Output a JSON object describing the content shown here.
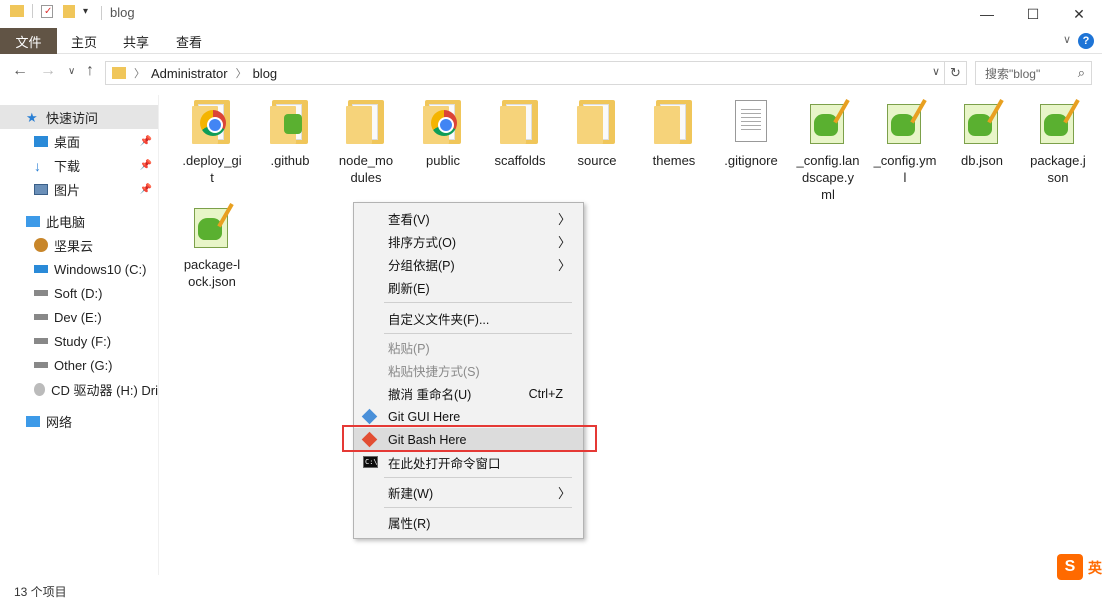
{
  "window": {
    "title": "blog",
    "minimize": "—",
    "maximize": "☐",
    "close": "✕"
  },
  "ribbon": {
    "file": "文件",
    "home": "主页",
    "share": "共享",
    "view": "查看",
    "collapse": "∨",
    "help": "?"
  },
  "nav": {
    "back": "←",
    "forward": "→",
    "recent": "∨",
    "up": "↑",
    "crumbs": [
      "Administrator",
      "blog"
    ],
    "search_placeholder": "搜索\"blog\""
  },
  "sidebar": {
    "items": [
      {
        "label": "快速访问",
        "icon": "star-icon"
      },
      {
        "label": "桌面",
        "icon": "desktop-icon"
      },
      {
        "label": "下载",
        "icon": "download-icon"
      },
      {
        "label": "图片",
        "icon": "pictures-icon"
      },
      {
        "label": "此电脑",
        "icon": "computer-icon"
      },
      {
        "label": "坚果云",
        "icon": "nutstore-icon"
      },
      {
        "label": "Windows10 (C:)",
        "icon": "drive-icon"
      },
      {
        "label": "Soft (D:)",
        "icon": "drive-icon"
      },
      {
        "label": "Dev (E:)",
        "icon": "drive-icon"
      },
      {
        "label": "Study (F:)",
        "icon": "drive-icon"
      },
      {
        "label": "Other (G:)",
        "icon": "drive-icon"
      },
      {
        "label": "CD 驱动器 (H:) Dri",
        "icon": "cd-drive-icon"
      },
      {
        "label": "网络",
        "icon": "network-icon"
      }
    ]
  },
  "files": [
    {
      "name": ".deploy_git",
      "line1": ".deploy_gi",
      "line2": "t",
      "icon": "folder-chrome-icon"
    },
    {
      "name": ".github",
      "line1": ".github",
      "line2": "",
      "icon": "folder-notepad-icon"
    },
    {
      "name": "node_modules",
      "line1": "node_mo",
      "line2": "dules",
      "icon": "folder-icon"
    },
    {
      "name": "public",
      "line1": "public",
      "line2": "",
      "icon": "folder-chrome-icon"
    },
    {
      "name": "scaffolds",
      "line1": "scaffolds",
      "line2": "",
      "icon": "folder-icon"
    },
    {
      "name": "source",
      "line1": "source",
      "line2": "",
      "icon": "folder-icon"
    },
    {
      "name": "themes",
      "line1": "themes",
      "line2": "",
      "icon": "folder-icon"
    },
    {
      "name": ".gitignore",
      "line1": ".gitignore",
      "line2": "",
      "icon": "document-icon"
    },
    {
      "name": "_config.landscape.yml",
      "line1": "_config.lan",
      "line2": "dscape.y",
      "line3": "ml",
      "icon": "notepadpp-icon"
    },
    {
      "name": "_config.yml",
      "line1": "_config.ym",
      "line2": "l",
      "icon": "notepadpp-icon"
    },
    {
      "name": "db.json",
      "line1": "db.json",
      "line2": "",
      "icon": "notepadpp-icon"
    },
    {
      "name": "package.json",
      "line1": "package.j",
      "line2": "son",
      "icon": "notepadpp-icon"
    },
    {
      "name": "package-lock.json",
      "line1": "package-l",
      "line2": "ock.json",
      "icon": "notepadpp-icon"
    }
  ],
  "context_menu": {
    "view": "查看(V)",
    "sort": "排序方式(O)",
    "group": "分组依据(P)",
    "refresh": "刷新(E)",
    "customize": "自定义文件夹(F)...",
    "paste": "粘贴(P)",
    "paste_shortcut": "粘贴快捷方式(S)",
    "undo": "撤消 重命名(U)",
    "undo_shortcut": "Ctrl+Z",
    "git_gui": "Git GUI Here",
    "git_bash": "Git Bash Here",
    "cmd_here": "在此处打开命令窗口",
    "new": "新建(W)",
    "properties": "属性(R)",
    "submenu_arrow": "〉",
    "cmd_icon_text": "C:\\"
  },
  "status": {
    "count": "13 个项目"
  },
  "ime": {
    "logo": "S",
    "lang": "英"
  },
  "colors": {
    "file_tab": "#615445",
    "highlight_box": "#e53935",
    "menu_bg": "#f2f2f2"
  }
}
